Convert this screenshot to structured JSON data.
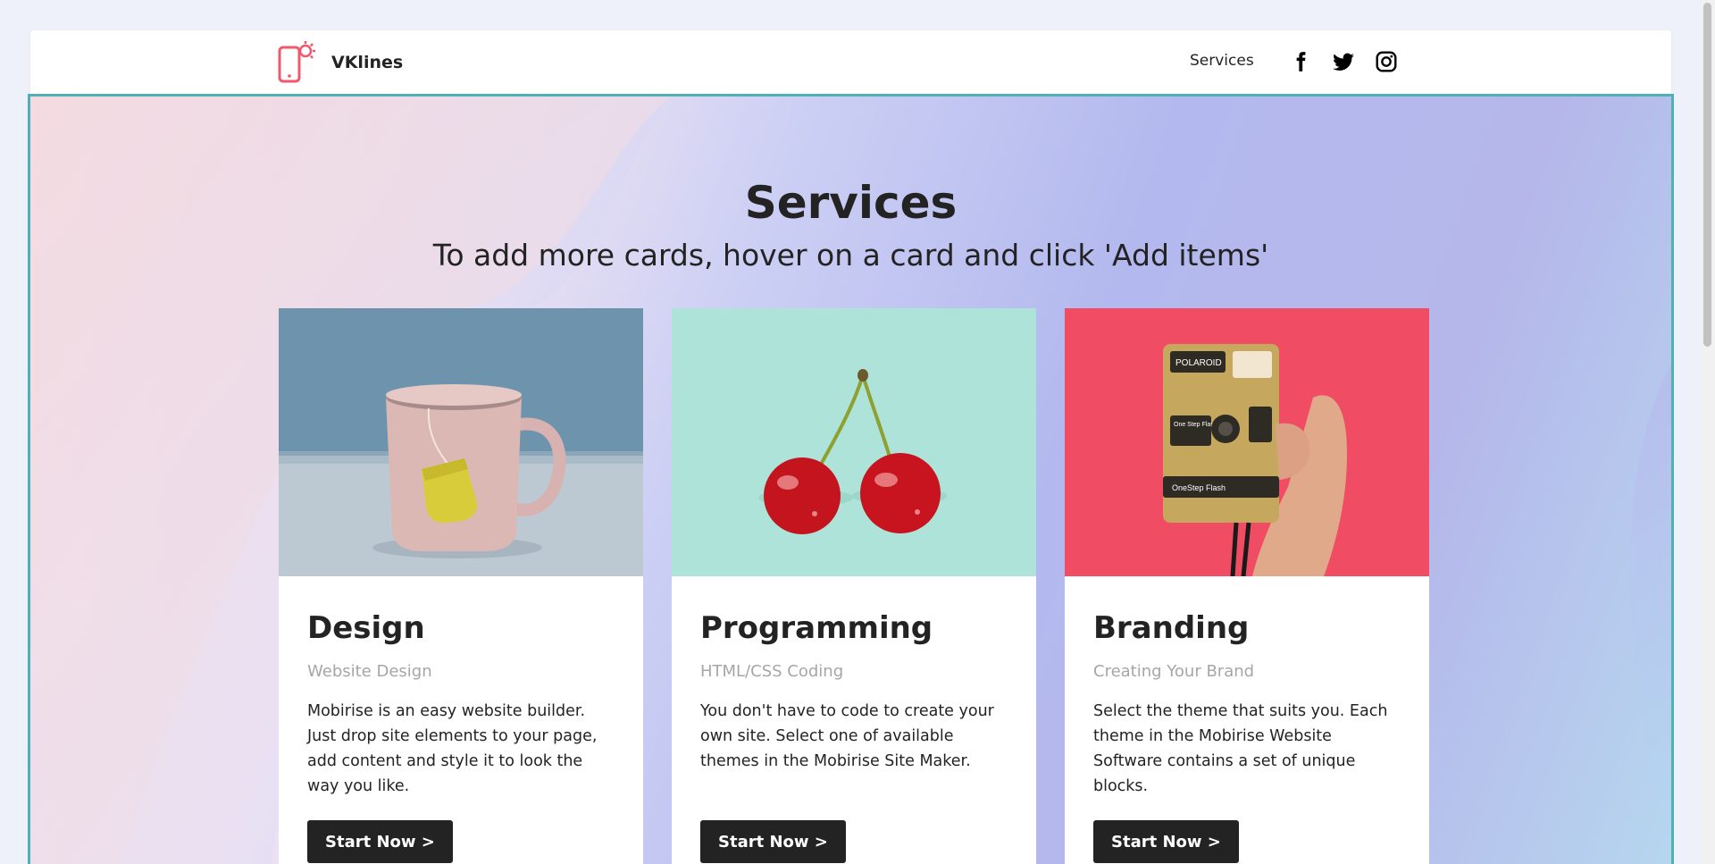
{
  "navbar": {
    "brand_name": "VKlines",
    "links": [
      "Services"
    ],
    "social": [
      "facebook-icon",
      "twitter-icon",
      "instagram-icon"
    ]
  },
  "colors": {
    "accent": "#f0596b",
    "dark": "#232323",
    "frame_border": "#4fb1b5"
  },
  "section": {
    "title": "Services",
    "subtitle": "To add more cards, hover on a card and click 'Add items'"
  },
  "cards": [
    {
      "title": "Design",
      "subtitle": "Website Design",
      "text": "Mobirise is an easy website builder. Just drop site elements to your page, add content and style it to look the way you like.",
      "button": "Start Now >",
      "image": "pink-mug-with-tea-bag"
    },
    {
      "title": "Programming",
      "subtitle": "HTML/CSS Coding",
      "text": "You don't have to code to create your own site. Select one of available themes in the Mobirise Site Maker.",
      "button": "Start Now >",
      "image": "cherries-on-mint"
    },
    {
      "title": "Branding",
      "subtitle": "Creating Your Brand",
      "text": "Select the theme that suits you. Each theme in the Mobirise Website Software contains a set of unique blocks.",
      "button": "Start Now >",
      "image": "hand-holding-polaroid-camera"
    }
  ],
  "camera_labels": {
    "brand": "POLAROID",
    "button": "One Step Flash",
    "strip": "OneStep Flash"
  }
}
